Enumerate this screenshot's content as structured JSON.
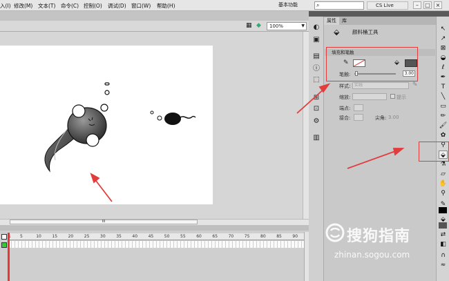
{
  "menu": {
    "items": [
      "入(I)",
      "修改(M)",
      "文本(T)",
      "命令(C)",
      "控制(O)",
      "调试(D)",
      "窗口(W)",
      "帮助(H)"
    ],
    "workspace": "基本功能",
    "cslive": "CS Live"
  },
  "stage": {
    "zoom": "100%",
    "hscroll_label": "III"
  },
  "timeline": {
    "frame_ticks": [
      "5",
      "10",
      "15",
      "20",
      "25",
      "30",
      "35",
      "40",
      "45",
      "50",
      "55",
      "60",
      "65",
      "70",
      "75",
      "80",
      "85",
      "90"
    ],
    "current_frame": "1"
  },
  "properties": {
    "tab_properties": "属性",
    "tab_library": "库",
    "tool_name": "颜料桶工具",
    "section_title": "填充和笔触",
    "stroke_label": "笔触:",
    "stroke_value": "3.00",
    "style_label": "样式:",
    "style_value": "实线",
    "scale_label": "缩放:",
    "hint_label": "提示",
    "cap_label": "端点:",
    "join_label": "接合:",
    "miter_label": "尖角:",
    "miter_value": "3.00"
  },
  "colors": {
    "accent_red": "#e23c3c",
    "stroke_swatch": "#ffffff",
    "fill_swatch": "#555555"
  },
  "watermark": {
    "brand": "搜狗指南",
    "url": "zhinan.sogou.com"
  }
}
